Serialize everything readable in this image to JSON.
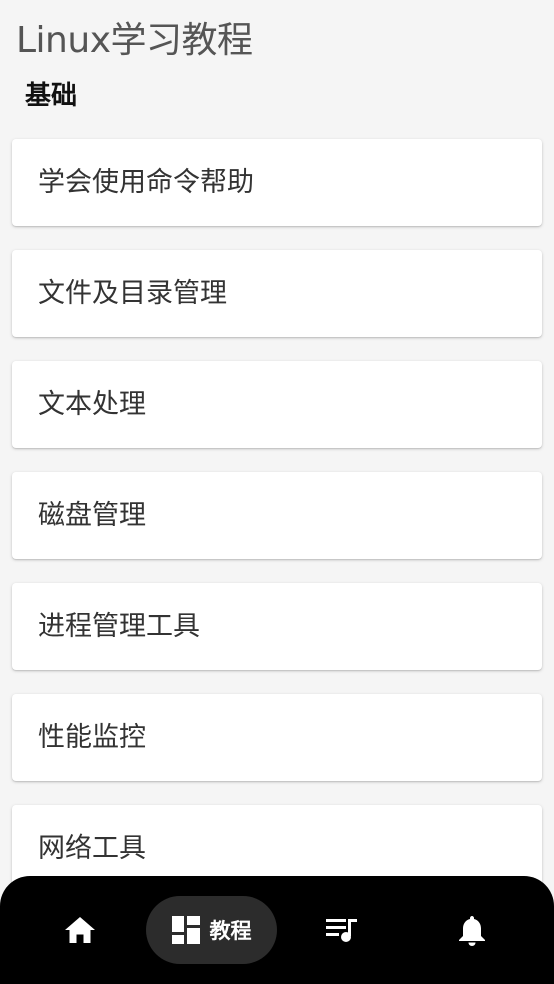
{
  "app": {
    "title": "Linux学习教程"
  },
  "section": {
    "title": "基础"
  },
  "cards": [
    {
      "label": "学会使用命令帮助"
    },
    {
      "label": "文件及目录管理"
    },
    {
      "label": "文本处理"
    },
    {
      "label": "磁盘管理"
    },
    {
      "label": "进程管理工具"
    },
    {
      "label": "性能监控"
    },
    {
      "label": "网络工具"
    }
  ],
  "bottom_nav": {
    "items": [
      {
        "icon": "home-icon",
        "label": "",
        "active": false
      },
      {
        "icon": "dashboard-icon",
        "label": "教程",
        "active": true
      },
      {
        "icon": "playlist-icon",
        "label": "",
        "active": false
      },
      {
        "icon": "bell-icon",
        "label": "",
        "active": false
      }
    ]
  },
  "colors": {
    "background": "#f5f5f5",
    "card": "#ffffff",
    "nav_background": "#000000",
    "nav_active_pill": "#2c2c2c",
    "nav_icon": "#ffffff"
  }
}
